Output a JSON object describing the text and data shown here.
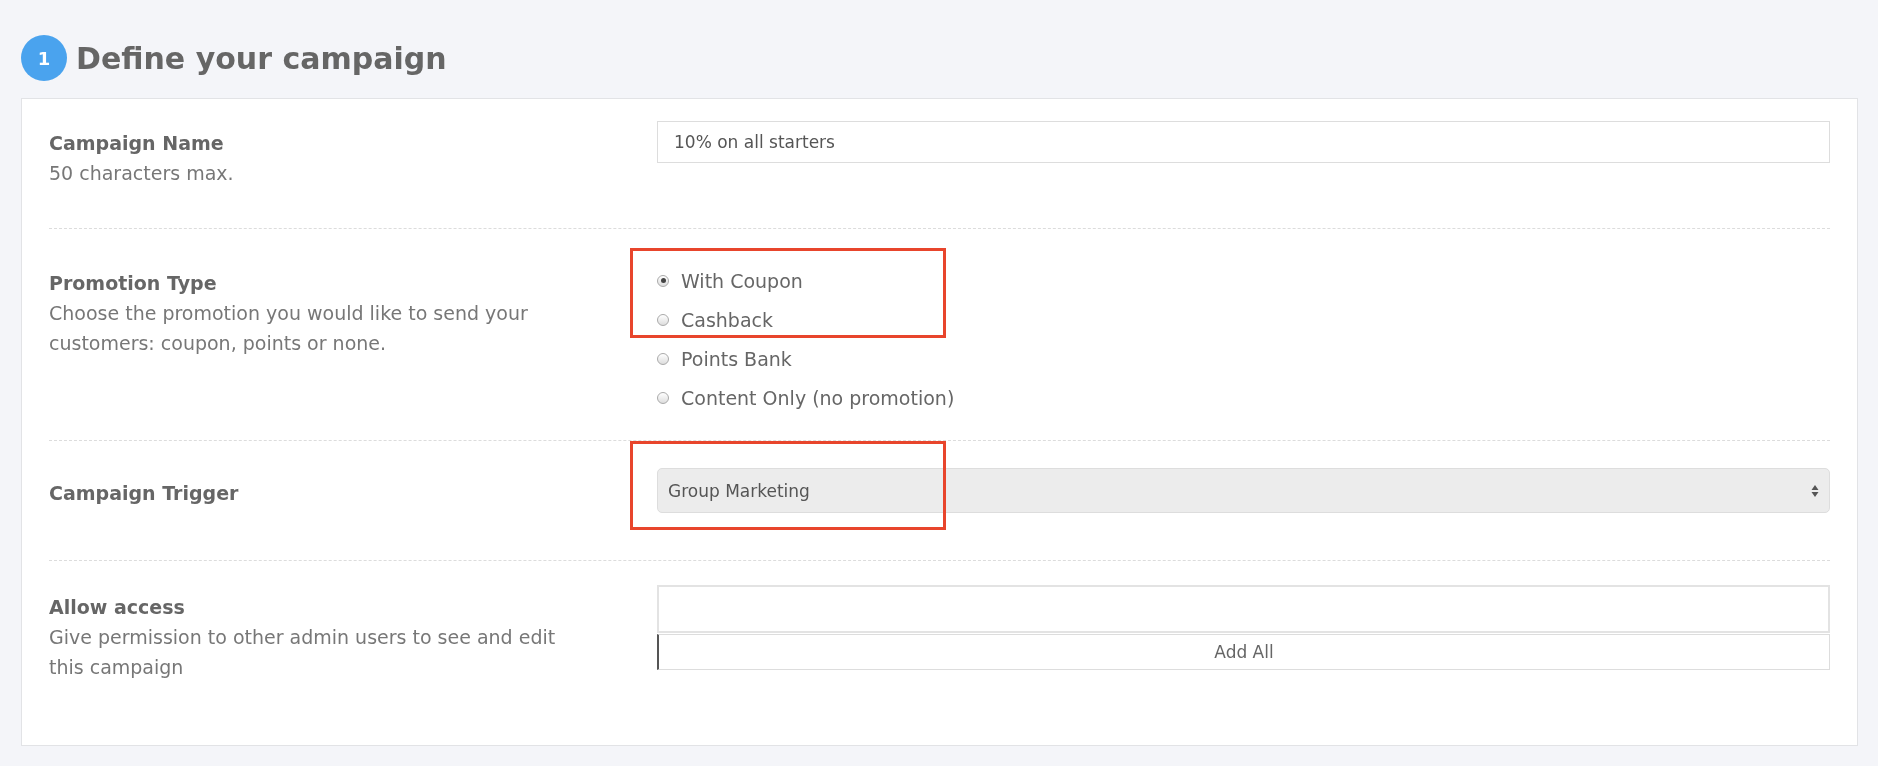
{
  "step": {
    "number": "1",
    "title": "Define your campaign"
  },
  "campaign_name": {
    "label": "Campaign Name",
    "hint": "50 characters max.",
    "value": "10% on all starters"
  },
  "promotion_type": {
    "label": "Promotion Type",
    "hint": "Choose the promotion you would like to send your customers: coupon, points or none.",
    "highlighted": true,
    "options": [
      {
        "label": "With Coupon",
        "selected": true
      },
      {
        "label": "Cashback",
        "selected": false
      },
      {
        "label": "Points Bank",
        "selected": false
      },
      {
        "label": "Content Only (no promotion)",
        "selected": false
      }
    ]
  },
  "campaign_trigger": {
    "label": "Campaign Trigger",
    "value": "Group Marketing",
    "highlighted": true
  },
  "allow_access": {
    "label": "Allow access",
    "hint": "Give permission to other admin users to see and edit this campaign",
    "button": "Add All"
  }
}
